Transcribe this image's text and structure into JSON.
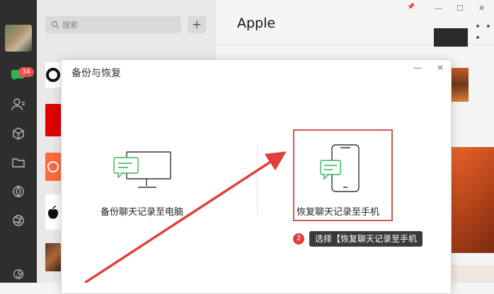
{
  "nav": {
    "unread_badge": "34",
    "icons": [
      "chat-icon",
      "contacts-icon",
      "favorites-cube-icon",
      "files-folder-icon",
      "moments-icon",
      "channels-aperture-icon",
      "mini-programs-icon"
    ]
  },
  "search": {
    "placeholder": "搜索"
  },
  "chat": {
    "title": "Apple"
  },
  "window_controls": {
    "pin": "📌",
    "minimize": "—",
    "maximize": "☐",
    "close": "✕"
  },
  "modal": {
    "title": "备份与恢复",
    "minimize": "—",
    "close": "✕",
    "options": [
      {
        "label": "备份聊天记录至电脑"
      },
      {
        "label": "恢复聊天记录至手机"
      }
    ]
  },
  "annotation": {
    "step_number": "2",
    "tip_text": "选择【恢复聊天记录至手机",
    "colors": {
      "highlight": "#d9534f",
      "arrow": "#e0403a",
      "tip_bg": "#3a3a3a"
    }
  }
}
